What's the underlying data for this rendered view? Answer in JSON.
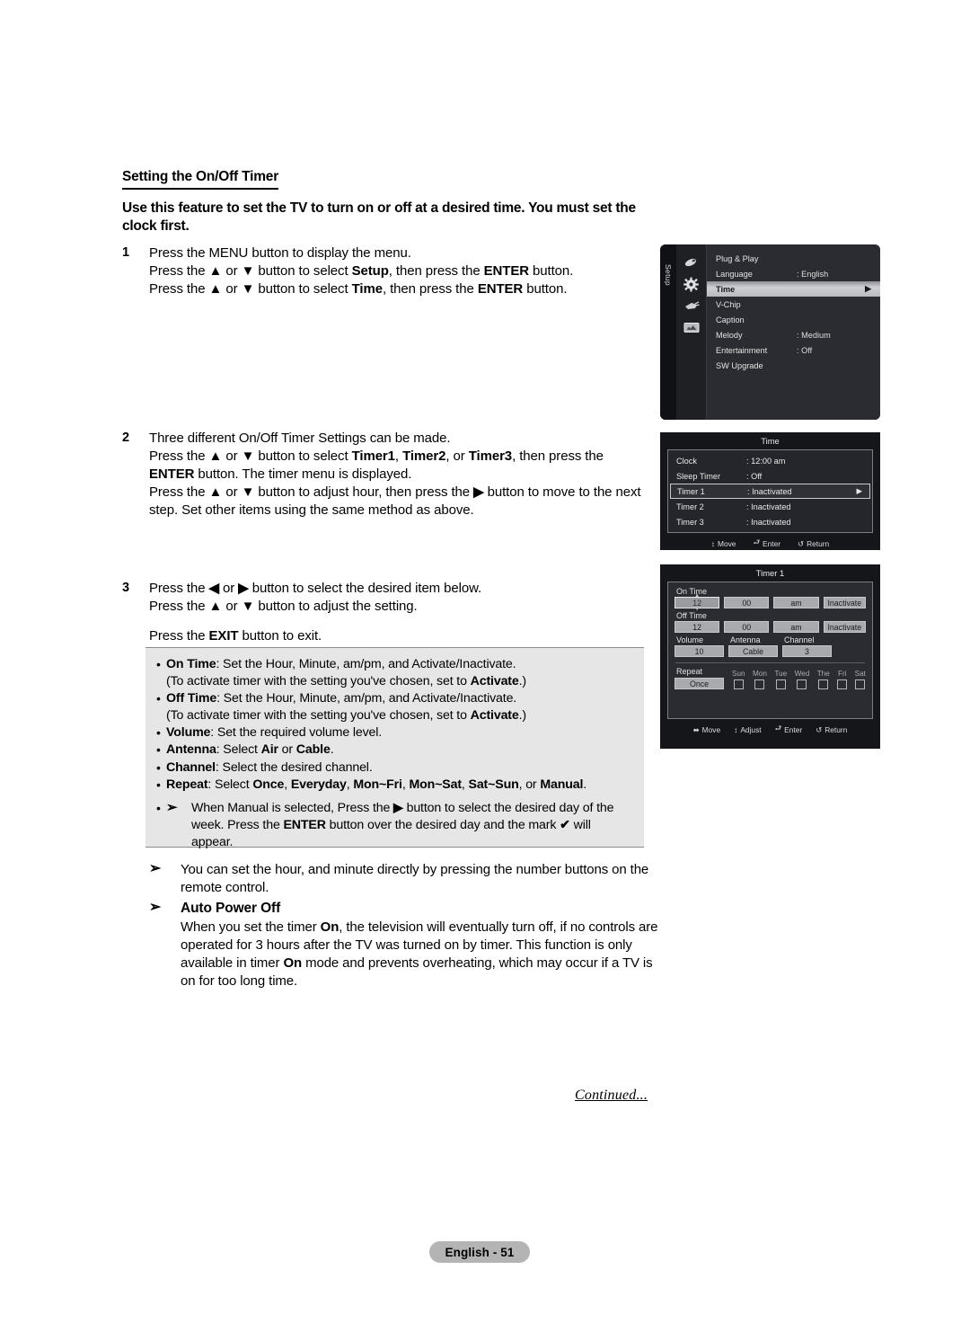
{
  "section": {
    "title": "Setting the On/Off Timer",
    "lead": "Use this feature to set the TV to turn on or off at a desired time. You must set the clock first."
  },
  "steps": [
    {
      "num": "1",
      "lines": [
        "Press the MENU button to display the menu.",
        "Press the ▲ or ▼ button to select Setup, then press the ENTER button.",
        "Press the ▲ or ▼ button to select Time, then press the ENTER button."
      ]
    },
    {
      "num": "2",
      "lines": [
        "Three different On/Off Timer Settings can be made.",
        "Press the ▲ or ▼ button to select Timer1, Timer2, or Timer3, then press the ENTER button. The timer menu is displayed.",
        "Press the ▲ or ▼ button to adjust hour, then press the ▶ button to move to the next step. Set other items using the same method as above."
      ]
    },
    {
      "num": "3",
      "lines": [
        "Press the ◀ or ▶ button to select the desired item below.",
        "Press the ▲ or ▼ button to adjust the setting.",
        "Press the EXIT button to exit."
      ]
    }
  ],
  "bullets": [
    {
      "dot": "•",
      "term": "On Time",
      "rest": ": Set the Hour, Minute, am/pm, and Activate/Inactivate.",
      "sub": "(To activate timer with the setting you've chosen, set to Activate.)"
    },
    {
      "dot": "•",
      "term": "Off Time",
      "rest": ": Set the Hour, Minute, am/pm, and Activate/Inactivate.",
      "sub": "(To activate timer with the setting you've chosen, set to Activate.)"
    },
    {
      "dot": "•",
      "term": "Volume",
      "rest": ": Set the required volume level.",
      "sub": ""
    },
    {
      "dot": "•",
      "term": "Antenna",
      "rest": ": Select Air or Cable.",
      "sub": ""
    },
    {
      "dot": "•",
      "term": "Channel",
      "rest": ": Select the desired channel.",
      "sub": ""
    },
    {
      "dot": "•",
      "term": "Repeat",
      "rest": ": Select Once, Everyday, Mon~Fri, Mon~Sat, Sat~Sun, or Manual.",
      "sub": ""
    }
  ],
  "bullet_note": {
    "dot": "•",
    "arrow": "➢",
    "text": "When Manual is selected, Press the ▶ button to select the desired day of the week. Press the ENTER button over the desired day and the mark ✔ will appear."
  },
  "notes": [
    {
      "arrow": "➢",
      "heading": "",
      "text": "You can set the hour, and minute directly by pressing the number buttons on the remote control."
    },
    {
      "arrow": "➢",
      "heading": "Auto Power Off",
      "text": "When you set the timer On, the television will eventually turn off, if no controls are operated for 3 hours after the TV was turned on by timer. This function is only available in timer On mode and prevents overheating, which may occur if a TV is on for too long time."
    }
  ],
  "continued": "Continued...",
  "footer": {
    "page_label": "English - 51"
  },
  "osd_setup": {
    "tab_label": "Setup",
    "icons": [
      "hand-pointer-icon",
      "gear-icon",
      "plug-icon",
      "screen-icon"
    ],
    "rows": [
      {
        "label": "Plug & Play",
        "value": "",
        "selected": false
      },
      {
        "label": "Language",
        "value": ": English",
        "selected": false
      },
      {
        "label": "Time",
        "value": "",
        "selected": true
      },
      {
        "label": "V-Chip",
        "value": "",
        "selected": false
      },
      {
        "label": "Caption",
        "value": "",
        "selected": false
      },
      {
        "label": "Melody",
        "value": ": Medium",
        "selected": false
      },
      {
        "label": "Entertainment",
        "value": ": Off",
        "selected": false
      },
      {
        "label": "SW Upgrade",
        "value": "",
        "selected": false
      }
    ],
    "caret": "▶"
  },
  "osd_time": {
    "title": "Time",
    "rows": [
      {
        "label": "Clock",
        "value": ": 12:00 am",
        "selected": false
      },
      {
        "label": "Sleep Timer",
        "value": ": Off",
        "selected": false
      },
      {
        "label": "Timer 1",
        "value": ": Inactivated",
        "selected": true
      },
      {
        "label": "Timer 2",
        "value": ": Inactivated",
        "selected": false
      },
      {
        "label": "Timer 3",
        "value": ": Inactivated",
        "selected": false
      }
    ],
    "caret": "▶",
    "footer": [
      {
        "icon": "↕",
        "label": "Move"
      },
      {
        "icon": "⮐",
        "label": "Enter"
      },
      {
        "icon": "↺",
        "label": "Return"
      }
    ]
  },
  "osd_timer1": {
    "title": "Timer 1",
    "on_time_label": "On Time",
    "on_time": [
      "12",
      "00",
      "am",
      "Inactivate"
    ],
    "off_time_label": "Off Time",
    "off_time": [
      "12",
      "00",
      "am",
      "Inactivate"
    ],
    "trio_labels": [
      "Volume",
      "Antenna",
      "Channel"
    ],
    "trio_values": [
      "10",
      "Cable",
      "3"
    ],
    "repeat_label": "Repeat",
    "repeat_value": "Once",
    "days": [
      "Sun",
      "Mon",
      "Tue",
      "Wed",
      "The",
      "Fri",
      "Sat"
    ],
    "footer": [
      {
        "icon": "⬌",
        "label": "Move"
      },
      {
        "icon": "↕",
        "label": "Adjust"
      },
      {
        "icon": "⮐",
        "label": "Enter"
      },
      {
        "icon": "↺",
        "label": "Return"
      }
    ]
  }
}
